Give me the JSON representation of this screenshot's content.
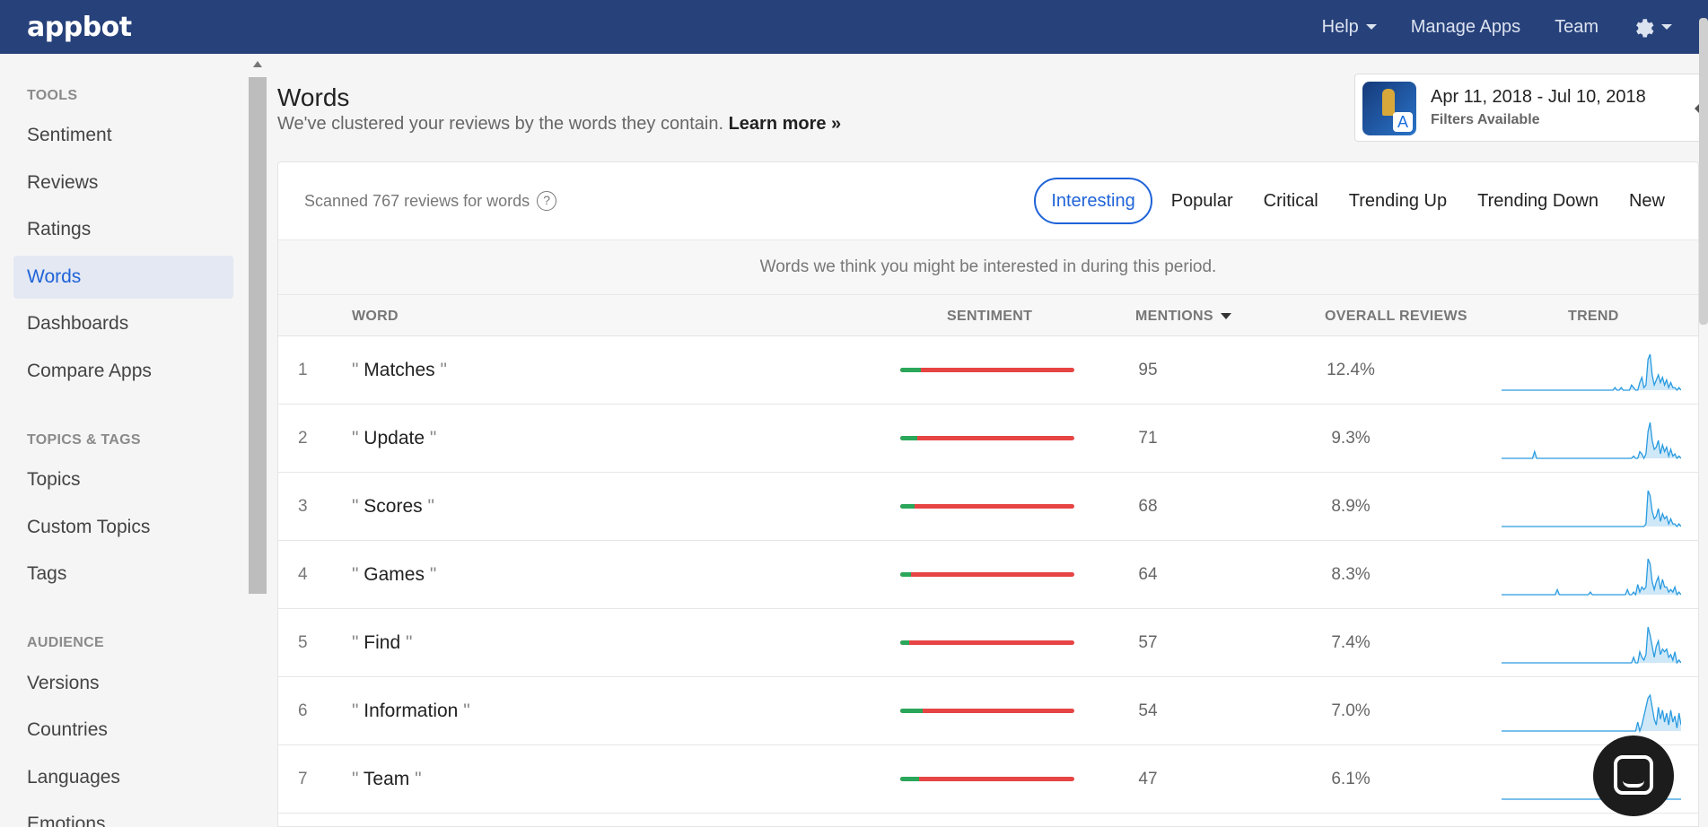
{
  "topbar": {
    "logo": "appbot",
    "nav": [
      {
        "label": "Help"
      },
      {
        "label": "Manage Apps"
      },
      {
        "label": "Team"
      }
    ]
  },
  "sidebar": {
    "sections": [
      {
        "title": "TOOLS",
        "items": [
          "Sentiment",
          "Reviews",
          "Ratings",
          "Words",
          "Dashboards",
          "Compare Apps"
        ]
      },
      {
        "title": "TOPICS & TAGS",
        "items": [
          "Topics",
          "Custom Topics",
          "Tags"
        ]
      },
      {
        "title": "AUDIENCE",
        "items": [
          "Versions",
          "Countries",
          "Languages",
          "Emotions"
        ]
      }
    ],
    "active": "Words"
  },
  "header": {
    "title": "Words",
    "subtitle": "We've clustered your reviews by the words they contain.",
    "learn_more": "Learn more »"
  },
  "date_card": {
    "range": "Apr 11, 2018 - Jul 10, 2018",
    "filters": "Filters Available",
    "app_icon": "app-icon-fifa"
  },
  "card": {
    "scanned": "Scanned 767 reviews for words",
    "help_icon": "?",
    "tabs": [
      "Interesting",
      "Popular",
      "Critical",
      "Trending Up",
      "Trending Down",
      "New"
    ],
    "active_tab": "Interesting",
    "info": "Words we think you might be interested in during this period."
  },
  "table": {
    "headers": {
      "word": "WORD",
      "sentiment": "SENTIMENT",
      "mentions": "MENTIONS",
      "overall": "OVERALL REVIEWS",
      "trend": "TREND"
    },
    "rows": [
      {
        "rank": "1",
        "word": "Matches",
        "positive_fraction": 0.12,
        "mentions": "95",
        "overall": "12.4%",
        "trend": [
          0,
          0,
          0,
          0,
          0,
          0,
          0,
          0,
          0,
          0,
          0,
          0,
          0,
          0,
          0,
          0,
          0,
          0,
          0,
          0,
          0,
          0,
          0,
          0,
          0,
          0,
          0,
          0,
          0,
          0,
          0,
          0,
          0,
          0,
          0,
          0,
          0,
          0,
          0,
          0,
          0,
          0,
          0,
          0,
          0,
          0,
          0,
          0,
          0,
          0,
          0,
          0,
          0,
          0,
          0,
          1,
          0,
          0,
          1,
          0,
          0,
          0,
          0,
          2,
          1,
          0,
          0,
          3,
          5,
          1,
          2,
          12,
          14,
          6,
          2,
          4,
          6,
          3,
          5,
          2,
          4,
          1,
          3,
          1,
          1,
          0,
          1,
          0
        ]
      },
      {
        "rank": "2",
        "word": "Update",
        "positive_fraction": 0.1,
        "mentions": "71",
        "overall": "9.3%",
        "trend": [
          0,
          0,
          0,
          0,
          0,
          0,
          0,
          0,
          0,
          0,
          0,
          0,
          0,
          0,
          0,
          0,
          3,
          0,
          0,
          0,
          0,
          0,
          0,
          0,
          0,
          0,
          0,
          0,
          0,
          0,
          0,
          0,
          0,
          0,
          0,
          0,
          0,
          0,
          0,
          0,
          0,
          0,
          0,
          0,
          0,
          0,
          0,
          0,
          0,
          0,
          0,
          0,
          0,
          0,
          0,
          0,
          0,
          0,
          0,
          0,
          0,
          0,
          0,
          0,
          1,
          0,
          0,
          3,
          2,
          0,
          2,
          12,
          16,
          8,
          4,
          5,
          8,
          2,
          6,
          3,
          5,
          1,
          4,
          1,
          2,
          0,
          1,
          0
        ]
      },
      {
        "rank": "3",
        "word": "Scores",
        "positive_fraction": 0.08,
        "mentions": "68",
        "overall": "8.9%",
        "trend": [
          0,
          0,
          0,
          0,
          0,
          0,
          0,
          0,
          0,
          0,
          0,
          0,
          0,
          0,
          0,
          0,
          0,
          0,
          0,
          0,
          0,
          0,
          0,
          0,
          0,
          0,
          0,
          0,
          0,
          0,
          0,
          0,
          0,
          0,
          0,
          0,
          0,
          0,
          0,
          0,
          0,
          0,
          0,
          0,
          0,
          0,
          0,
          0,
          0,
          0,
          0,
          0,
          0,
          0,
          0,
          0,
          0,
          0,
          0,
          0,
          0,
          0,
          0,
          0,
          0,
          0,
          0,
          0,
          0,
          0,
          1,
          14,
          12,
          6,
          3,
          4,
          7,
          2,
          5,
          3,
          4,
          1,
          3,
          1,
          1,
          0,
          1,
          0
        ]
      },
      {
        "rank": "4",
        "word": "Games",
        "positive_fraction": 0.06,
        "mentions": "64",
        "overall": "8.3%",
        "trend": [
          0,
          0,
          0,
          0,
          0,
          0,
          0,
          0,
          0,
          0,
          0,
          0,
          0,
          0,
          0,
          0,
          0,
          0,
          0,
          0,
          0,
          0,
          0,
          0,
          0,
          0,
          0,
          2,
          0,
          0,
          0,
          0,
          0,
          0,
          0,
          0,
          0,
          0,
          0,
          0,
          0,
          0,
          0,
          1,
          0,
          0,
          0,
          0,
          0,
          0,
          0,
          0,
          0,
          0,
          0,
          0,
          0,
          0,
          0,
          0,
          0,
          2,
          0,
          0,
          1,
          0,
          4,
          1,
          3,
          2,
          3,
          14,
          12,
          5,
          2,
          5,
          7,
          2,
          6,
          3,
          3,
          1,
          2,
          1,
          3,
          0,
          1,
          0
        ]
      },
      {
        "rank": "5",
        "word": "Find",
        "positive_fraction": 0.05,
        "mentions": "57",
        "overall": "7.4%",
        "trend": [
          0,
          0,
          0,
          0,
          0,
          0,
          0,
          0,
          0,
          0,
          0,
          0,
          0,
          0,
          0,
          0,
          0,
          0,
          0,
          0,
          0,
          0,
          0,
          0,
          0,
          0,
          0,
          0,
          0,
          0,
          0,
          0,
          0,
          0,
          0,
          0,
          0,
          0,
          0,
          0,
          0,
          0,
          0,
          0,
          0,
          0,
          0,
          0,
          0,
          0,
          0,
          0,
          0,
          0,
          0,
          0,
          0,
          0,
          0,
          0,
          0,
          0,
          0,
          0,
          2,
          0,
          0,
          4,
          2,
          1,
          3,
          13,
          10,
          6,
          2,
          6,
          8,
          3,
          5,
          4,
          5,
          2,
          3,
          1,
          4,
          0,
          1,
          0
        ]
      },
      {
        "rank": "6",
        "word": "Information",
        "positive_fraction": 0.13,
        "mentions": "54",
        "overall": "7.0%",
        "trend": [
          0,
          0,
          0,
          0,
          0,
          0,
          0,
          0,
          0,
          0,
          0,
          0,
          0,
          0,
          0,
          0,
          0,
          0,
          0,
          0,
          0,
          0,
          0,
          0,
          0,
          0,
          0,
          0,
          0,
          0,
          0,
          0,
          0,
          0,
          0,
          0,
          0,
          0,
          0,
          0,
          0,
          0,
          0,
          0,
          0,
          0,
          0,
          0,
          0,
          0,
          0,
          0,
          0,
          0,
          0,
          0,
          0,
          0,
          0,
          0,
          0,
          0,
          0,
          0,
          0,
          0,
          3,
          0,
          2,
          5,
          8,
          11,
          12,
          8,
          4,
          2,
          8,
          4,
          7,
          3,
          6,
          2,
          7,
          3,
          5,
          1,
          6,
          2
        ]
      },
      {
        "rank": "7",
        "word": "Team",
        "positive_fraction": 0.11,
        "mentions": "47",
        "overall": "6.1%",
        "trend": [
          0,
          0,
          0,
          0,
          0,
          0,
          0,
          0,
          0,
          0,
          0,
          0,
          0,
          0,
          0,
          0,
          0,
          0,
          0,
          0,
          0,
          0,
          0,
          0,
          0,
          0,
          0,
          0,
          0,
          0,
          0,
          0,
          0,
          0,
          0,
          0,
          0,
          0,
          0,
          0,
          0,
          0,
          0,
          0,
          0,
          0,
          0,
          0,
          0,
          0,
          0,
          0,
          0,
          0,
          0,
          0,
          0,
          0,
          0,
          0,
          0,
          6,
          0,
          0,
          0,
          0,
          0,
          0,
          0,
          0,
          0,
          2,
          0,
          0,
          0,
          0,
          0,
          0,
          0,
          0,
          0,
          0,
          0,
          0,
          0,
          0,
          0,
          0
        ]
      }
    ]
  },
  "colors": {
    "nav_bg": "#27417a",
    "accent": "#1f63d8",
    "positive": "#2aa75a",
    "negative": "#e74444",
    "trend_line": "#2a9be0",
    "trend_fill": "#cfe8f8"
  },
  "icons": {
    "settings": "gear-icon",
    "chat": "chat-icon",
    "help": "question-circle-icon"
  }
}
